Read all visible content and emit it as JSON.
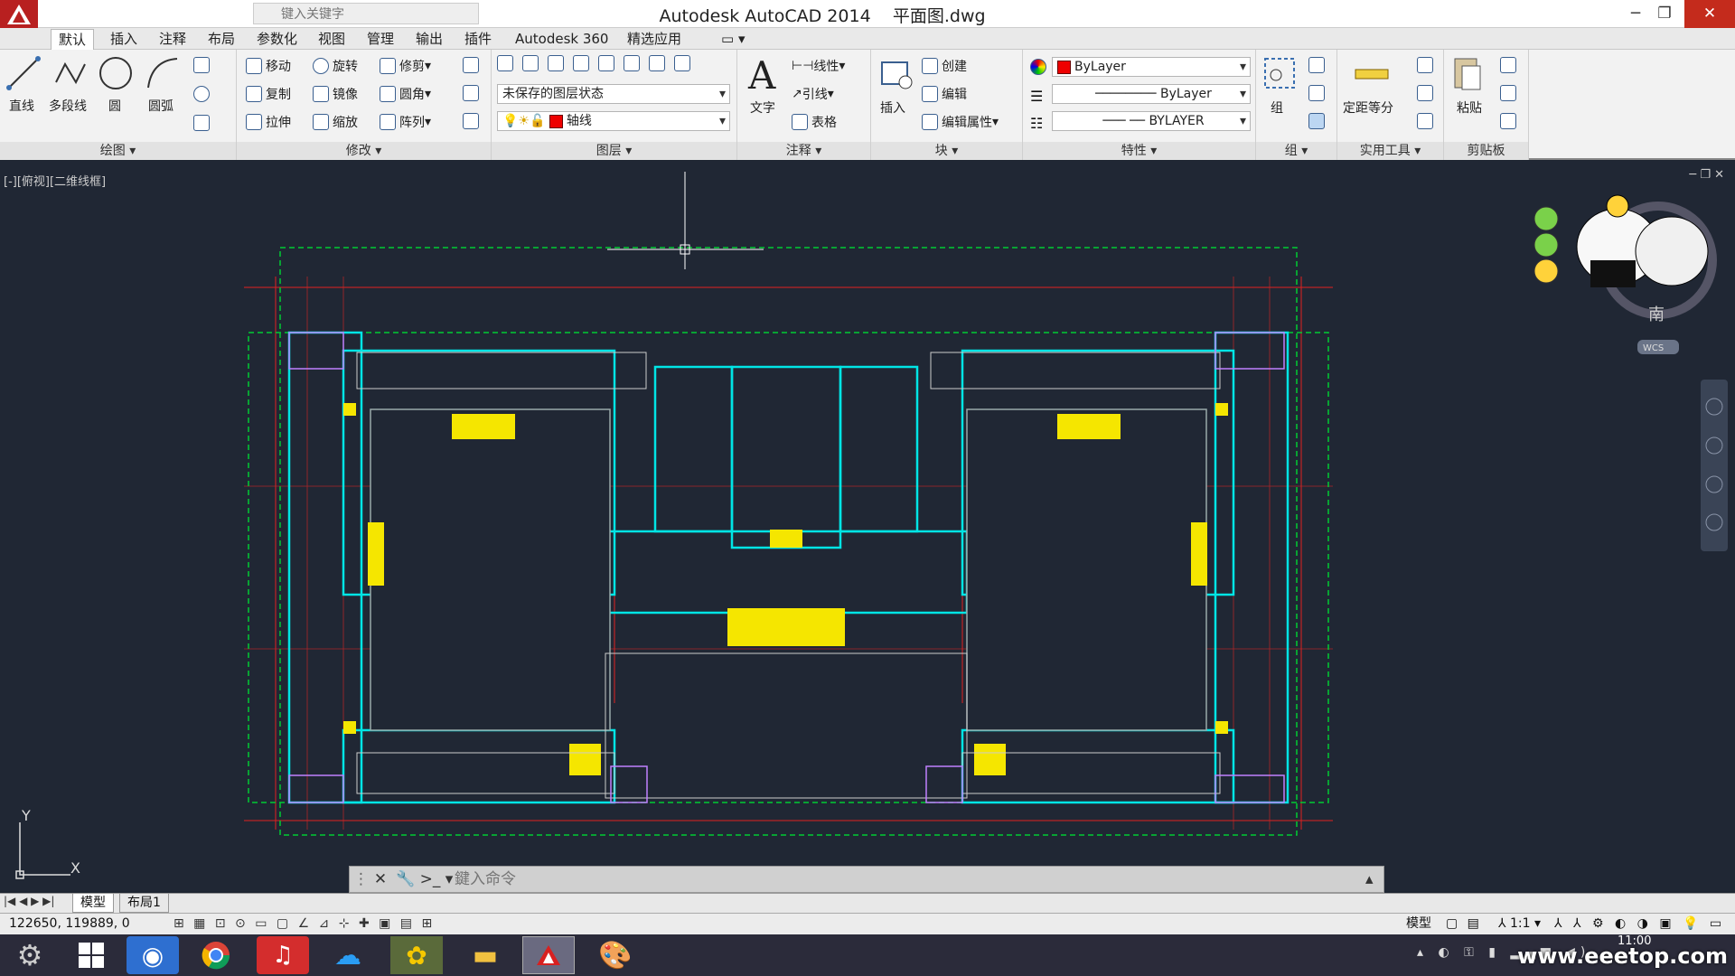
{
  "title_bar": {
    "search_placeholder": "键入关键字",
    "app_title": "Autodesk AutoCAD 2014",
    "file_name": "平面图.dwg"
  },
  "menu_tabs": [
    "默认",
    "插入",
    "注释",
    "布局",
    "参数化",
    "视图",
    "管理",
    "输出",
    "插件",
    "Autodesk 360",
    "精选应用"
  ],
  "ribbon": {
    "draw": {
      "title": "绘图",
      "items": [
        "直线",
        "多段线",
        "圆",
        "圆弧"
      ]
    },
    "modify": {
      "title": "修改",
      "items": [
        "移动",
        "旋转",
        "修剪",
        "复制",
        "镜像",
        "圆角",
        "拉伸",
        "缩放",
        "阵列"
      ]
    },
    "layers": {
      "title": "图层",
      "state": "未保存的图层状态",
      "current": "轴线"
    },
    "annotation": {
      "title": "注释",
      "text": "文字",
      "linear": "线性",
      "leader": "引线",
      "table": "表格"
    },
    "block": {
      "title": "块",
      "insert": "插入",
      "create": "创建",
      "edit": "编辑",
      "edit_attr": "编辑属性"
    },
    "properties": {
      "title": "特性",
      "color": "ByLayer",
      "lineweight": "ByLayer",
      "linetype": "BYLAYER"
    },
    "groups": {
      "title": "组",
      "group": "组"
    },
    "utilities": {
      "title": "实用工具",
      "measure": "定距等分"
    },
    "clipboard": {
      "title": "剪贴板",
      "paste": "粘贴"
    }
  },
  "viewport": {
    "label": "[-][俯视][二维线框]",
    "compass_south": "南",
    "wcs": "WCS",
    "axis_x": "X",
    "axis_y": "Y"
  },
  "command": {
    "placeholder": "鍵入命令"
  },
  "layout_tabs": [
    "模型",
    "布局1"
  ],
  "status": {
    "coords": "122650, 119889, 0",
    "model": "模型",
    "scale": "1:1"
  },
  "taskbar": {
    "time": "11:00"
  },
  "watermark": "www.eeetop.com",
  "colors": {
    "accent_red": "#e00000",
    "cad_bg": "#202734",
    "plan_cyan": "#00e5e5",
    "plan_green": "#00cc33",
    "plan_yellow": "#f5e600",
    "plan_red": "#e02020"
  }
}
